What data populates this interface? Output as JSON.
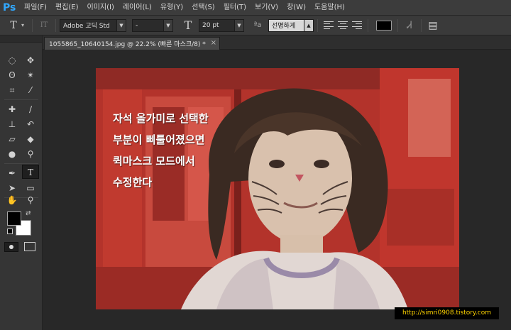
{
  "app": {
    "logo": "Ps"
  },
  "menu": [
    "파일(F)",
    "편집(E)",
    "이미지(I)",
    "레이어(L)",
    "유형(Y)",
    "선택(S)",
    "필터(T)",
    "보기(V)",
    "창(W)",
    "도움말(H)"
  ],
  "options": {
    "tool_glyph": "T",
    "orient_glyph": "IT",
    "font_family": "Adobe 고딕 Std",
    "font_style": "-",
    "size_glyph": "T",
    "font_size": "20 pt",
    "aa_glyph": "ªa",
    "antialias": "선명하게",
    "warp_glyph": "Ꮧ",
    "panel_glyph": "▤",
    "text_color": "#000000"
  },
  "document_tab": {
    "title": "1055865_10640154.jpg @ 22.2% (빠른 마스크/8) *",
    "close": "×"
  },
  "toolbox": {
    "foreground_color": "#000000",
    "background_color": "#ffffff"
  },
  "canvas": {
    "overlay_text": [
      "자석 올가미로 선택한",
      "부분이 삐툴어졌으면",
      "퀵마스크 모드에서",
      "수정한다"
    ],
    "mask_color": "#e02a1e"
  },
  "watermark": "http://simri0908.tistory.com"
}
